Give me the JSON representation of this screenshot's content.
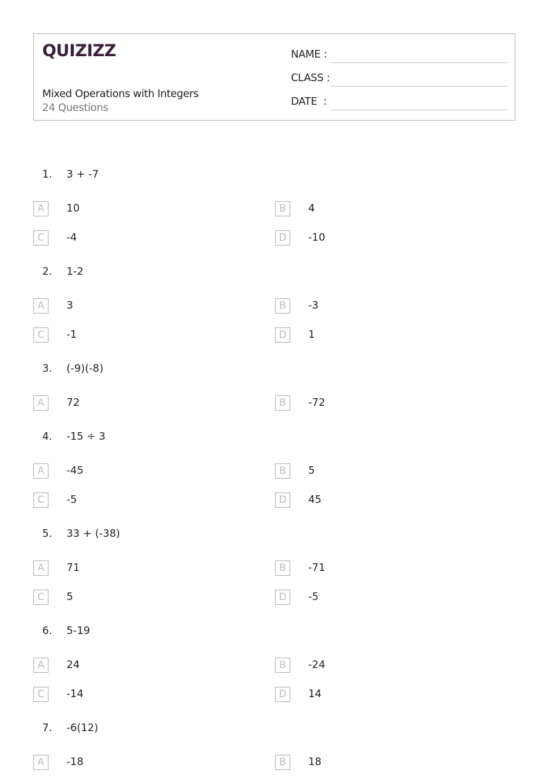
{
  "header": {
    "logo": "QUIZIZZ",
    "title": "Mixed Operations with Integers",
    "subtitle": "24 Questions",
    "fields": [
      {
        "label": "NAME :"
      },
      {
        "label": "CLASS :"
      },
      {
        "label": "DATE  :"
      }
    ]
  },
  "questions": [
    {
      "number": "1.",
      "text": "3 + -7",
      "options": [
        {
          "letter": "A",
          "text": "10"
        },
        {
          "letter": "B",
          "text": "4"
        },
        {
          "letter": "C",
          "text": "-4"
        },
        {
          "letter": "D",
          "text": "-10"
        }
      ]
    },
    {
      "number": "2.",
      "text": "1-2",
      "options": [
        {
          "letter": "A",
          "text": "3"
        },
        {
          "letter": "B",
          "text": "-3"
        },
        {
          "letter": "C",
          "text": "-1"
        },
        {
          "letter": "D",
          "text": "1"
        }
      ]
    },
    {
      "number": "3.",
      "text": "(-9)(-8)",
      "options": [
        {
          "letter": "A",
          "text": "72"
        },
        {
          "letter": "B",
          "text": "-72"
        }
      ]
    },
    {
      "number": "4.",
      "text": "-15 ÷ 3",
      "options": [
        {
          "letter": "A",
          "text": "-45"
        },
        {
          "letter": "B",
          "text": "5"
        },
        {
          "letter": "C",
          "text": "-5"
        },
        {
          "letter": "D",
          "text": "45"
        }
      ]
    },
    {
      "number": "5.",
      "text": "33 + (-38)",
      "options": [
        {
          "letter": "A",
          "text": "71"
        },
        {
          "letter": "B",
          "text": "-71"
        },
        {
          "letter": "C",
          "text": "5"
        },
        {
          "letter": "D",
          "text": "-5"
        }
      ]
    },
    {
      "number": "6.",
      "text": "5-19",
      "options": [
        {
          "letter": "A",
          "text": "24"
        },
        {
          "letter": "B",
          "text": "-24"
        },
        {
          "letter": "C",
          "text": "-14"
        },
        {
          "letter": "D",
          "text": "14"
        }
      ]
    },
    {
      "number": "7.",
      "text": "-6(12)",
      "options": [
        {
          "letter": "A",
          "text": "-18"
        },
        {
          "letter": "B",
          "text": "18"
        }
      ]
    }
  ]
}
